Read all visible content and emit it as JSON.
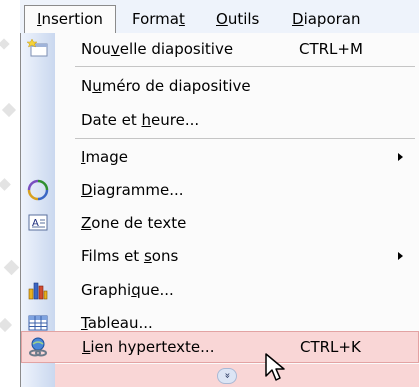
{
  "menubar": {
    "items": [
      {
        "label_u": "I",
        "label_rest": "nsertion",
        "active": true
      },
      {
        "label_pre": "Forma",
        "label_u": "t",
        "label_rest": ""
      },
      {
        "label_u": "O",
        "label_rest": "utils"
      },
      {
        "label_u": "D",
        "label_rest": "iaporan"
      }
    ]
  },
  "menu": {
    "items": [
      {
        "pre": "Nou",
        "u": "v",
        "post": "elle diapositive",
        "shortcut": "CTRL+M",
        "icon": "new-slide-icon"
      },
      {
        "pre": "N",
        "u": "u",
        "post": "méro de diapositive"
      },
      {
        "pre": "Date et ",
        "u": "h",
        "post": "eure..."
      },
      {
        "pre": "",
        "u": "I",
        "post": "mage",
        "submenu": true
      },
      {
        "pre": "",
        "u": "D",
        "post": "iagramme...",
        "icon": "diagram-icon"
      },
      {
        "pre": "",
        "u": "Z",
        "post": "one de texte",
        "icon": "text-box-icon"
      },
      {
        "pre": "Films et ",
        "u": "s",
        "post": "ons",
        "submenu": true
      },
      {
        "pre": "Graphi",
        "u": "q",
        "post": "ue...",
        "icon": "chart-icon"
      },
      {
        "pre": "",
        "u": "T",
        "post": "ableau...",
        "icon": "table-icon"
      },
      {
        "pre": "",
        "u": "L",
        "post": "ien hypertexte...",
        "shortcut": "CTRL+K",
        "icon": "hyperlink-icon",
        "highlighted": true
      }
    ],
    "expand_glyph": "»"
  },
  "colors": {
    "menubar_bg": "#eef3fb",
    "icon_column": "#cad8ef",
    "highlight": "#f9d6d6"
  }
}
